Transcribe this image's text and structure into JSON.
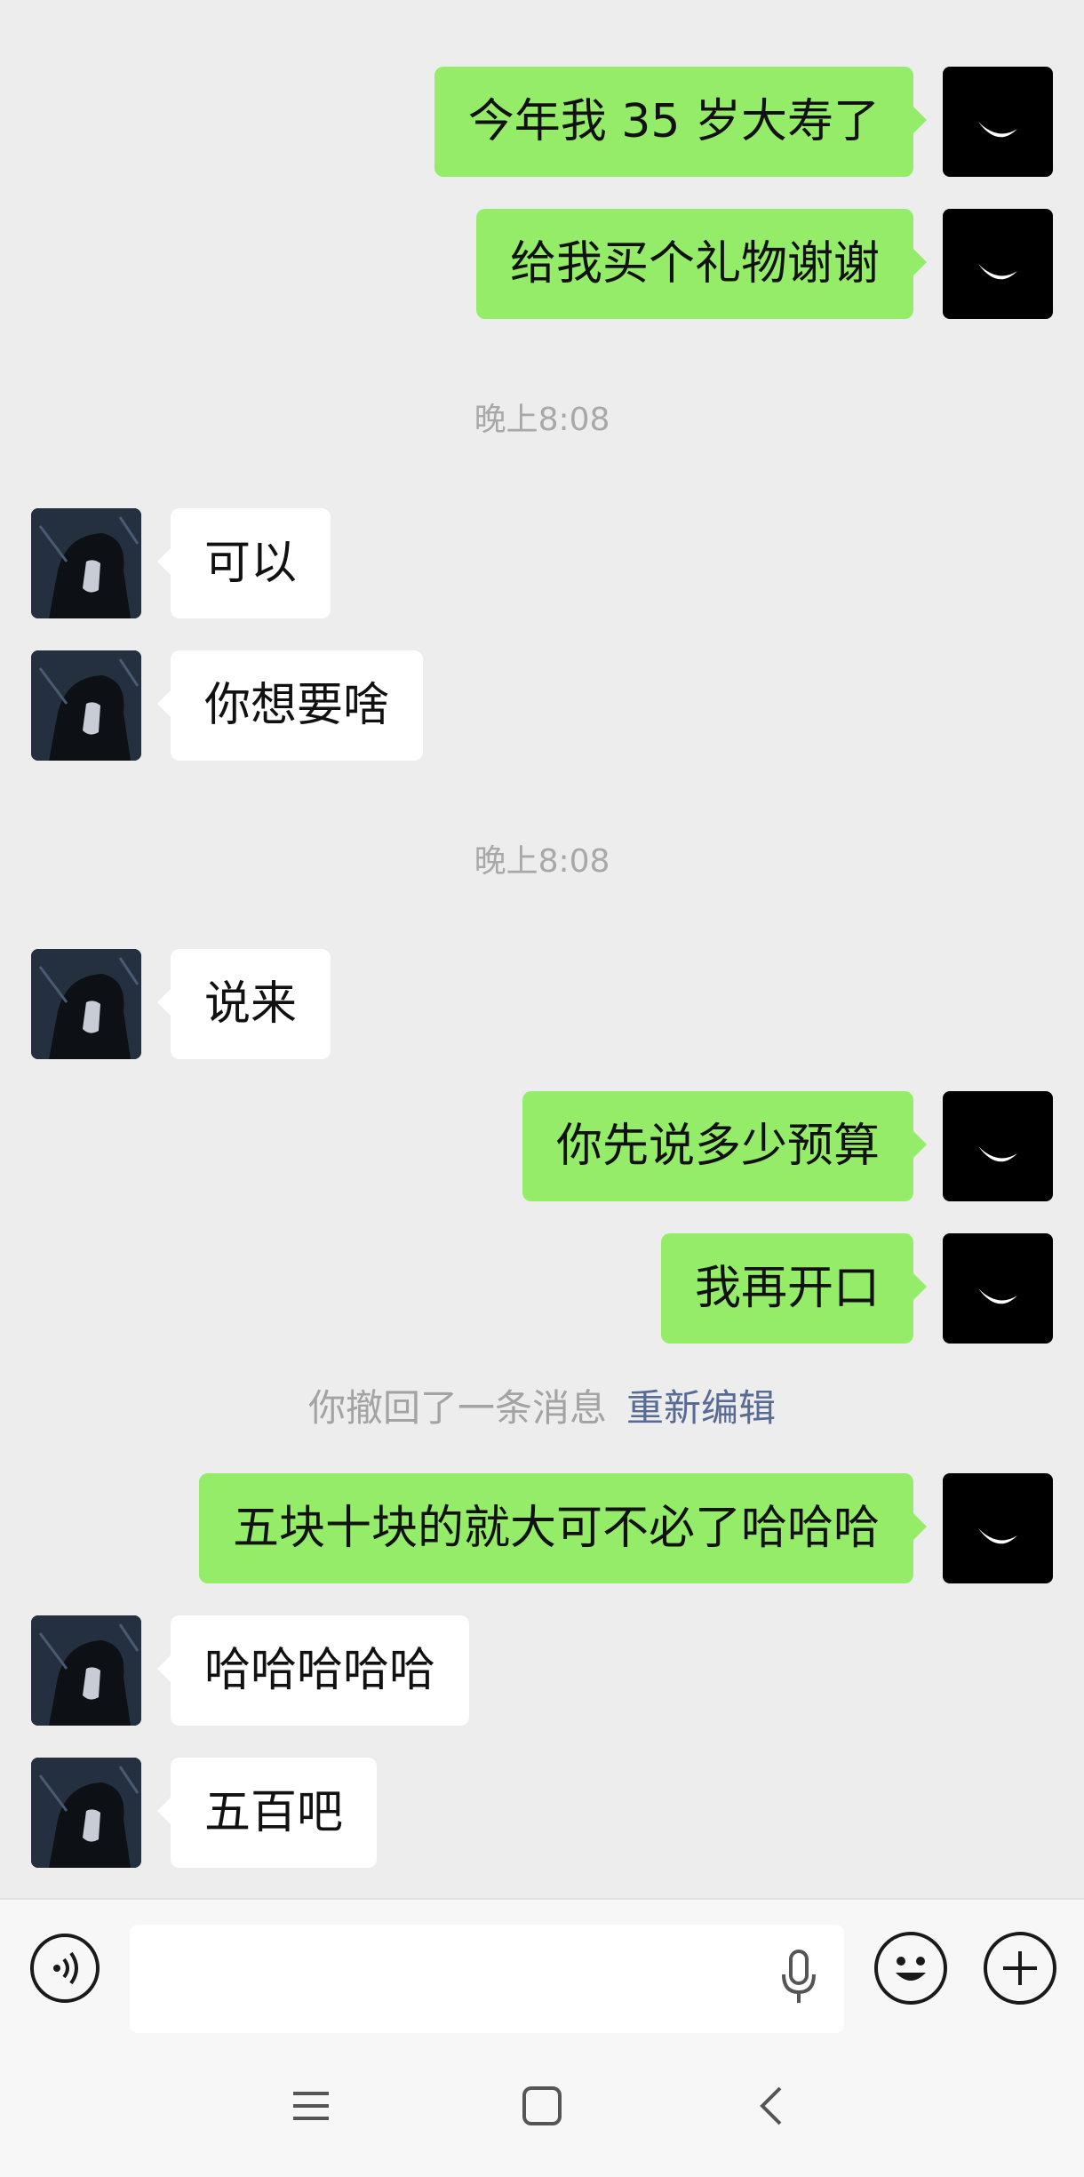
{
  "messages": [
    {
      "side": "me",
      "text": "今年我 35 岁大寿了"
    },
    {
      "side": "me",
      "text": "给我买个礼物谢谢"
    },
    {
      "side": "time",
      "text": "晚上8:08"
    },
    {
      "side": "other",
      "text": "可以"
    },
    {
      "side": "other",
      "text": "你想要啥"
    },
    {
      "side": "time",
      "text": "晚上8:08"
    },
    {
      "side": "other",
      "text": "说来"
    },
    {
      "side": "me",
      "text": "你先说多少预算"
    },
    {
      "side": "me",
      "text": "我再开口"
    },
    {
      "side": "recall",
      "text": "你撤回了一条消息",
      "action": "重新编辑"
    },
    {
      "side": "me",
      "text": "五块十块的就大可不必了哈哈哈"
    },
    {
      "side": "other",
      "text": "哈哈哈哈哈"
    },
    {
      "side": "other",
      "text": "五百吧"
    }
  ],
  "input_bar": {
    "voice_icon": "voice-icon",
    "mic_icon": "mic-icon",
    "emoji_icon": "emoji-icon",
    "more_icon": "plus-icon"
  },
  "nav_bar": {
    "menu_icon": "menu-icon",
    "home_icon": "home-icon",
    "back_icon": "back-icon"
  },
  "colors": {
    "chat_bg": "#ededed",
    "my_bubble": "#95ec69",
    "other_bubble": "#ffffff",
    "link": "#576b95"
  }
}
